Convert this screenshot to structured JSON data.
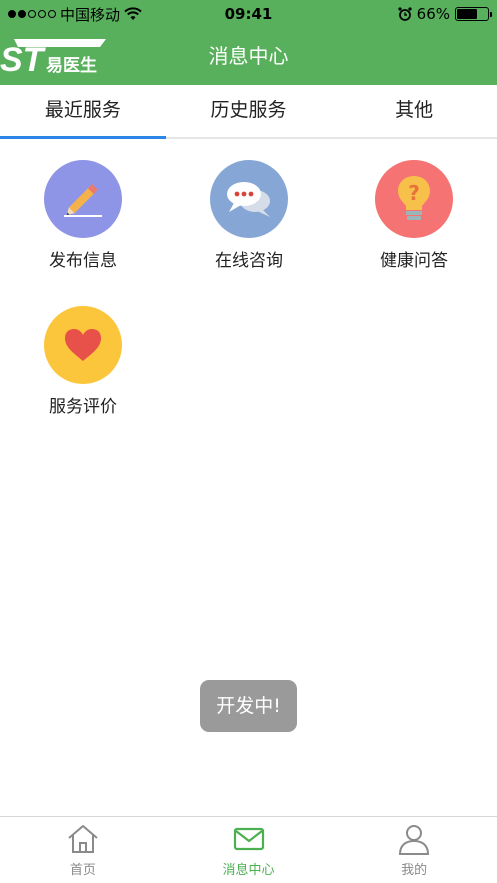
{
  "status": {
    "carrier": "中国移动",
    "time": "09:41",
    "battery": "66%",
    "battery_level": 0.66
  },
  "header": {
    "logo_text": "ST易医生",
    "title": "消息中心"
  },
  "tabs": [
    {
      "label": "最近服务"
    },
    {
      "label": "历史服务"
    },
    {
      "label": "其他"
    }
  ],
  "services": [
    {
      "label": "发布信息",
      "icon": "pencil-icon",
      "color": "#8f95e6"
    },
    {
      "label": "在线咨询",
      "icon": "chat-bubbles-icon",
      "color": "#86a7d6"
    },
    {
      "label": "健康问答",
      "icon": "lightbulb-question-icon",
      "color": "#f57373"
    },
    {
      "label": "服务评价",
      "icon": "heart-icon",
      "color": "#fcc63c"
    }
  ],
  "toast": {
    "text": "开发中!"
  },
  "tabbar": [
    {
      "label": "首页",
      "icon": "home-icon"
    },
    {
      "label": "消息中心",
      "icon": "mail-icon"
    },
    {
      "label": "我的",
      "icon": "user-icon"
    }
  ],
  "colors": {
    "brand": "#58b05c",
    "tab_indicator": "#2b86e8",
    "active_tab": "#4caf50"
  }
}
